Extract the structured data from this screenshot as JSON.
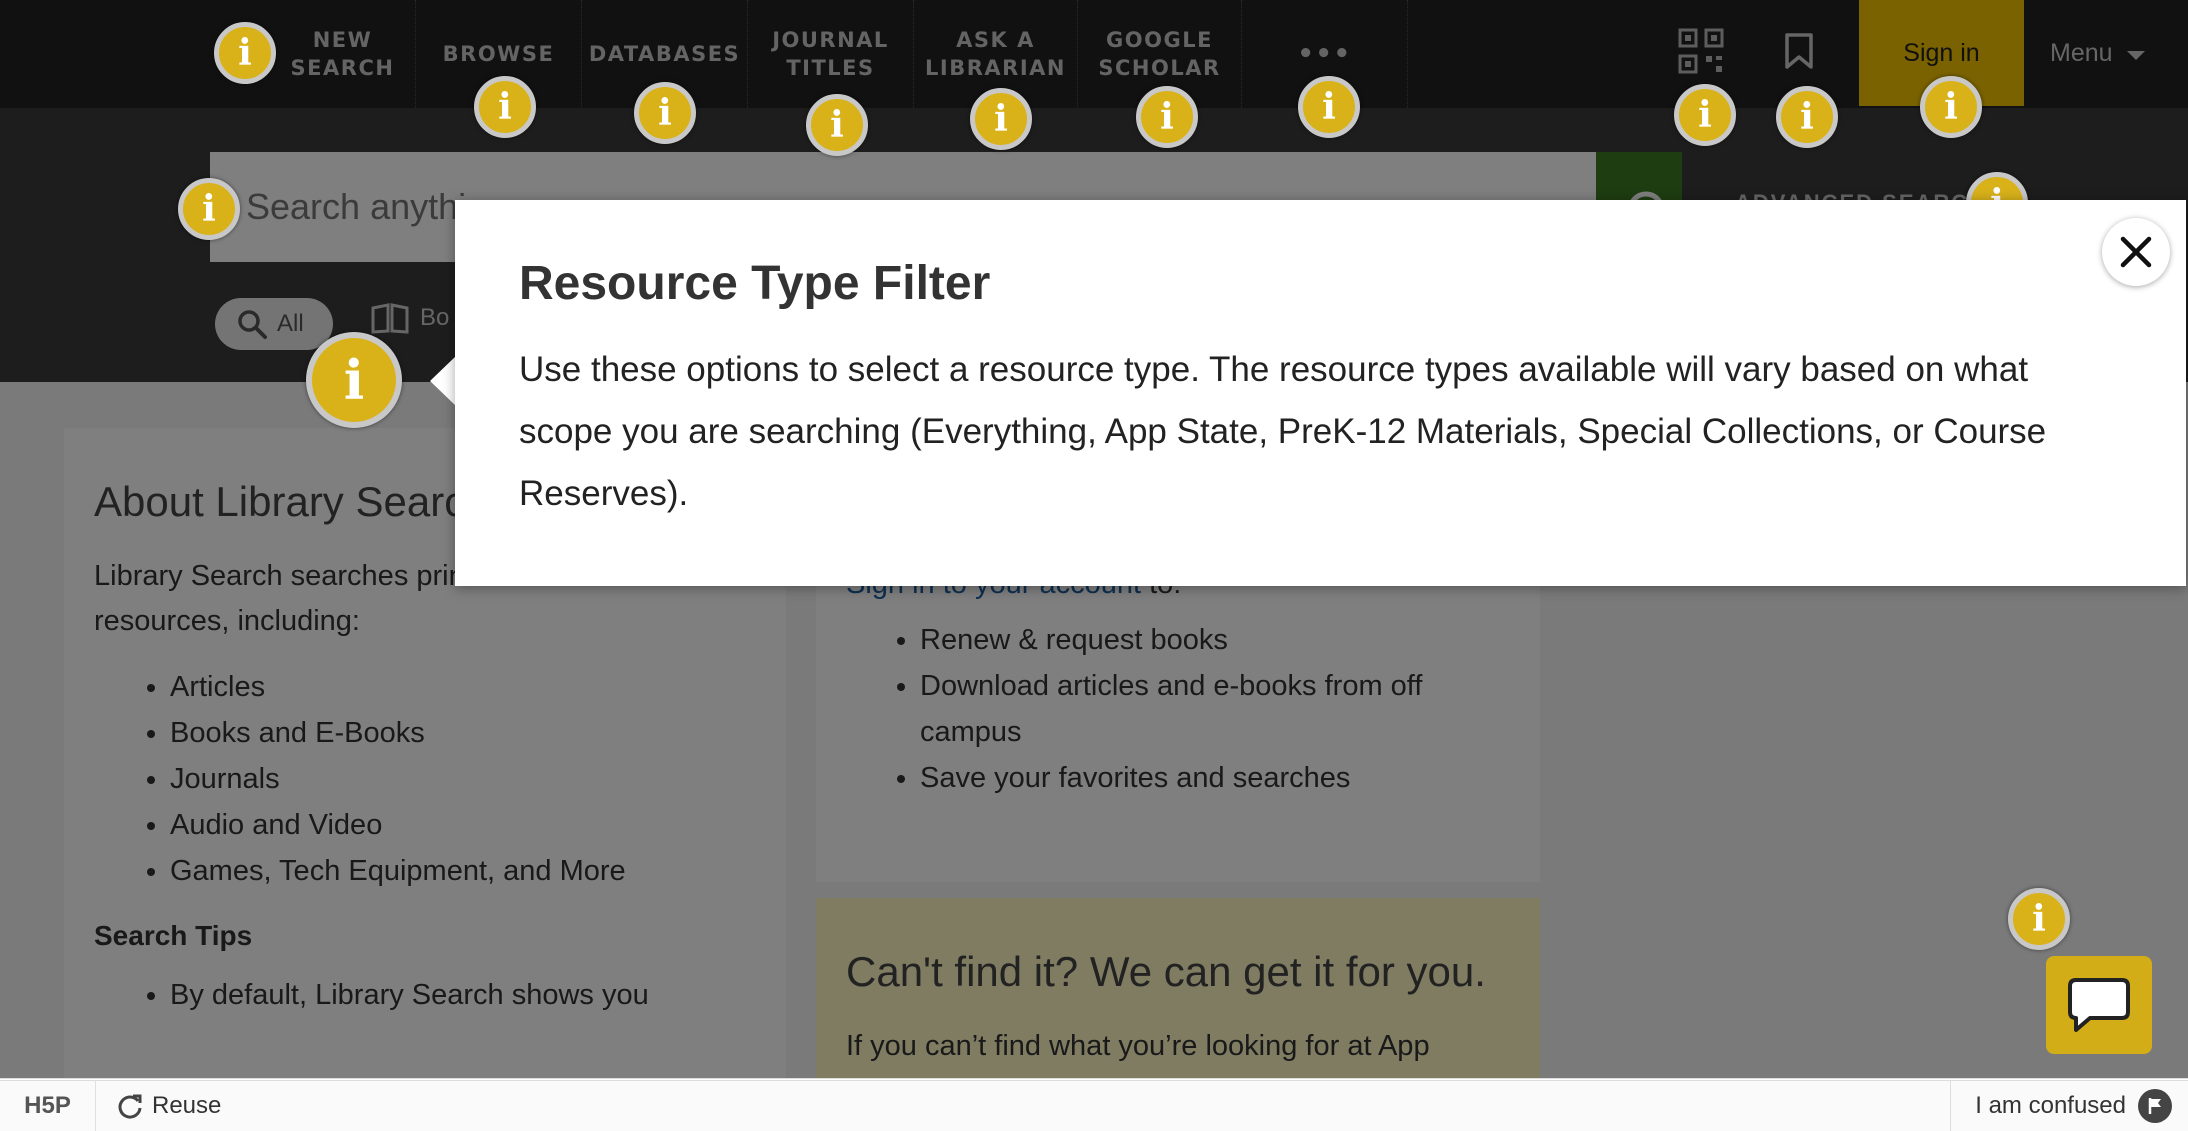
{
  "nav": {
    "items": [
      {
        "label_line1": "NEW",
        "label_line2": "SEARCH"
      },
      {
        "label_line1": "BROWSE",
        "label_line2": ""
      },
      {
        "label_line1": "DATABASES",
        "label_line2": ""
      },
      {
        "label_line1": "JOURNAL",
        "label_line2": "TITLES"
      },
      {
        "label_line1": "ASK A",
        "label_line2": "LIBRARIAN"
      },
      {
        "label_line1": "GOOGLE",
        "label_line2": "SCHOLAR"
      }
    ],
    "more": "•••",
    "signin": "Sign in",
    "menu": "Menu"
  },
  "search": {
    "placeholder": "Search anythi",
    "scope_all": "All",
    "scope_books": "Bo",
    "advanced": "ADVANCED SEARCH"
  },
  "about": {
    "title": "About Library Searc",
    "intro": "Library Search searches print and online resources, including:",
    "items": [
      "Articles",
      "Books and E-Books",
      "Journals",
      "Audio and Video",
      "Games, Tech Equipment, and More"
    ],
    "tips_title": "Search Tips",
    "tips": [
      "By default, Library Search shows you"
    ]
  },
  "account": {
    "link": "Sign in to your account",
    "suffix": " to:",
    "items": [
      "Renew & request books",
      "Download articles and e-books from off campus",
      "Save your favorites and searches"
    ]
  },
  "cantfind": {
    "title": "Can't find it? We can get it for you.",
    "text": "If you can’t find what you’re looking for at App"
  },
  "popup": {
    "title": "Resource Type Filter",
    "body": "Use these options to select a resource type. The resource types available will vary based on what scope you are searching (Everything, App State, PreK-12 Materials, Special Collections, or Course Reserves)."
  },
  "hotspot_glyph": "i",
  "footer": {
    "logo": "H5P",
    "reuse": "Reuse",
    "confused": "I am confused"
  },
  "colors": {
    "hotspot": "#d9b21a",
    "signin_bg": "#f4c400",
    "search_btn": "#3d7a23",
    "nav_bg": "#222222"
  }
}
